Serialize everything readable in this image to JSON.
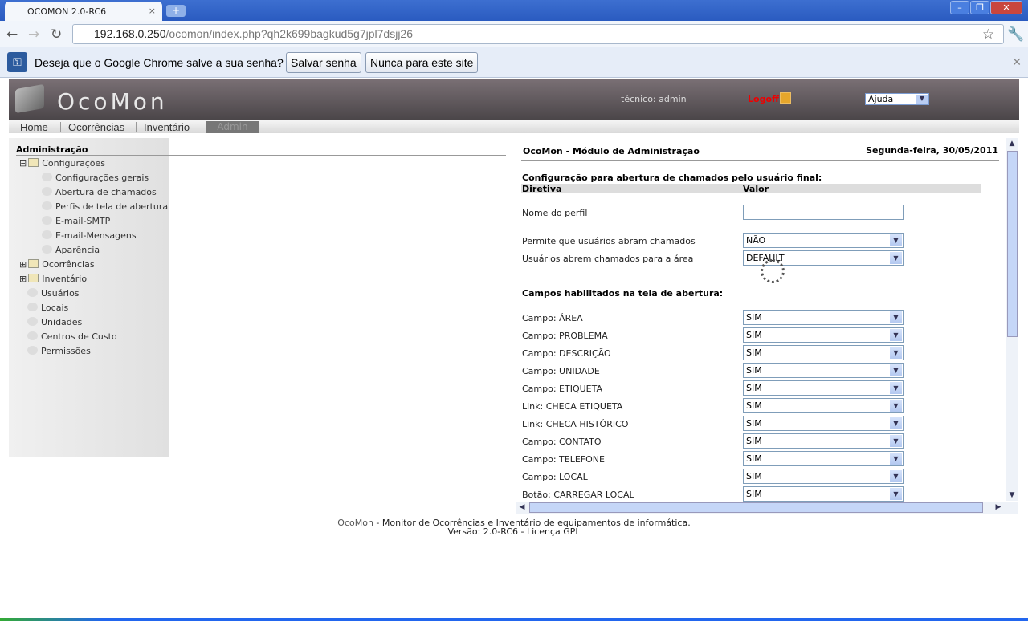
{
  "browser": {
    "tab_title": "OCOMON 2.0-RC6",
    "url_host": "192.168.0.250",
    "url_path": "/ocomon/index.php?qh2k699bagkud5g7jpl7dsjj26"
  },
  "infobar": {
    "message": "Deseja que o Google Chrome salve a sua senha?",
    "save": "Salvar senha",
    "never": "Nunca para este site"
  },
  "header": {
    "logo": "OcoMon",
    "user": "técnico: admin",
    "logoff": "Logoff",
    "help_select": "Ajuda"
  },
  "menu": [
    "Home",
    "Ocorrências",
    "Inventário",
    "Admin"
  ],
  "sidebar": {
    "title": "Administração",
    "items": [
      {
        "label": "Configurações",
        "level": 0,
        "type": "folder-open"
      },
      {
        "label": "Configurações gerais",
        "level": 1
      },
      {
        "label": "Abertura de chamados",
        "level": 1
      },
      {
        "label": "Perfis de tela de abertura",
        "level": 1
      },
      {
        "label": "E-mail-SMTP",
        "level": 1
      },
      {
        "label": "E-mail-Mensagens",
        "level": 1
      },
      {
        "label": "Aparência",
        "level": 1
      },
      {
        "label": "Ocorrências",
        "level": 0,
        "type": "folder"
      },
      {
        "label": "Inventário",
        "level": 0,
        "type": "folder"
      },
      {
        "label": "Usuários",
        "level": 0
      },
      {
        "label": "Locais",
        "level": 0
      },
      {
        "label": "Unidades",
        "level": 0
      },
      {
        "label": "Centros de Custo",
        "level": 0
      },
      {
        "label": "Permissões",
        "level": 0
      }
    ]
  },
  "main": {
    "title": "OcoMon - Módulo de Administração",
    "date": "Segunda-feira, 30/05/2011",
    "section1": "Configuração para abertura de chamados pelo usuário final:",
    "col_directive": "Diretiva",
    "col_value": "Valor",
    "profile_label": "Nome do perfil",
    "profile_value": "",
    "top_rows": [
      {
        "label": "Permite que usuários abram chamados",
        "value": "NÃO"
      },
      {
        "label": "Usuários abrem chamados para a área",
        "value": "DEFAULT"
      }
    ],
    "section2": "Campos habilitados na tela de abertura:",
    "fields": [
      {
        "label": "Campo: ÁREA",
        "value": "SIM"
      },
      {
        "label": "Campo: PROBLEMA",
        "value": "SIM"
      },
      {
        "label": "Campo: DESCRIÇÃO",
        "value": "SIM"
      },
      {
        "label": "Campo: UNIDADE",
        "value": "SIM"
      },
      {
        "label": "Campo: ETIQUETA",
        "value": "SIM"
      },
      {
        "label": "Link: CHECA ETIQUETA",
        "value": "SIM"
      },
      {
        "label": "Link: CHECA HISTÓRICO",
        "value": "SIM"
      },
      {
        "label": "Campo: CONTATO",
        "value": "SIM"
      },
      {
        "label": "Campo: TELEFONE",
        "value": "SIM"
      },
      {
        "label": "Campo: LOCAL",
        "value": "SIM"
      },
      {
        "label": "Botão: CARREGAR LOCAL",
        "value": "SIM"
      }
    ]
  },
  "footer": {
    "brand": "OcoMon",
    "line1": " - Monitor de Ocorrências e Inventário de equipamentos de informática.",
    "line2": "Versão: 2.0-RC6 - Licença GPL"
  }
}
